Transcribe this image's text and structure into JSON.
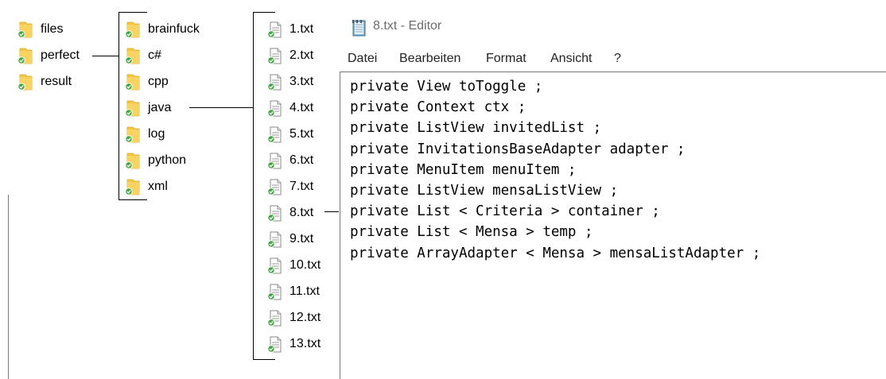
{
  "tree": {
    "root_items": [
      {
        "label": "files"
      },
      {
        "label": "perfect"
      },
      {
        "label": "result"
      }
    ],
    "perfect_items": [
      {
        "label": "brainfuck"
      },
      {
        "label": "c#"
      },
      {
        "label": "cpp"
      },
      {
        "label": "java"
      },
      {
        "label": "log"
      },
      {
        "label": "python"
      },
      {
        "label": "xml"
      }
    ],
    "java_files": [
      {
        "label": "1.txt"
      },
      {
        "label": "2.txt"
      },
      {
        "label": "3.txt"
      },
      {
        "label": "4.txt"
      },
      {
        "label": "5.txt"
      },
      {
        "label": "6.txt"
      },
      {
        "label": "7.txt"
      },
      {
        "label": "8.txt"
      },
      {
        "label": "9.txt"
      },
      {
        "label": "10.txt"
      },
      {
        "label": "11.txt"
      },
      {
        "label": "12.txt"
      },
      {
        "label": "13.txt"
      }
    ]
  },
  "editor": {
    "title": "8.txt - Editor",
    "menu": [
      "Datei",
      "Bearbeiten",
      "Format",
      "Ansicht",
      "?"
    ],
    "lines": [
      "private View toToggle ;",
      "private Context ctx ;",
      "private ListView invitedList ;",
      "private InvitationsBaseAdapter adapter ;",
      "private MenuItem menuItem ;",
      "private ListView mensaListView ;",
      "private List < Criteria > container ;",
      "private List < Mensa > temp ;",
      "private ArrayAdapter < Mensa > mensaListAdapter ;"
    ]
  },
  "colors": {
    "folder": "#f6c743",
    "check": "#3aa83a",
    "title_text": "#6d6d6d",
    "border": "#7a7a7a"
  }
}
